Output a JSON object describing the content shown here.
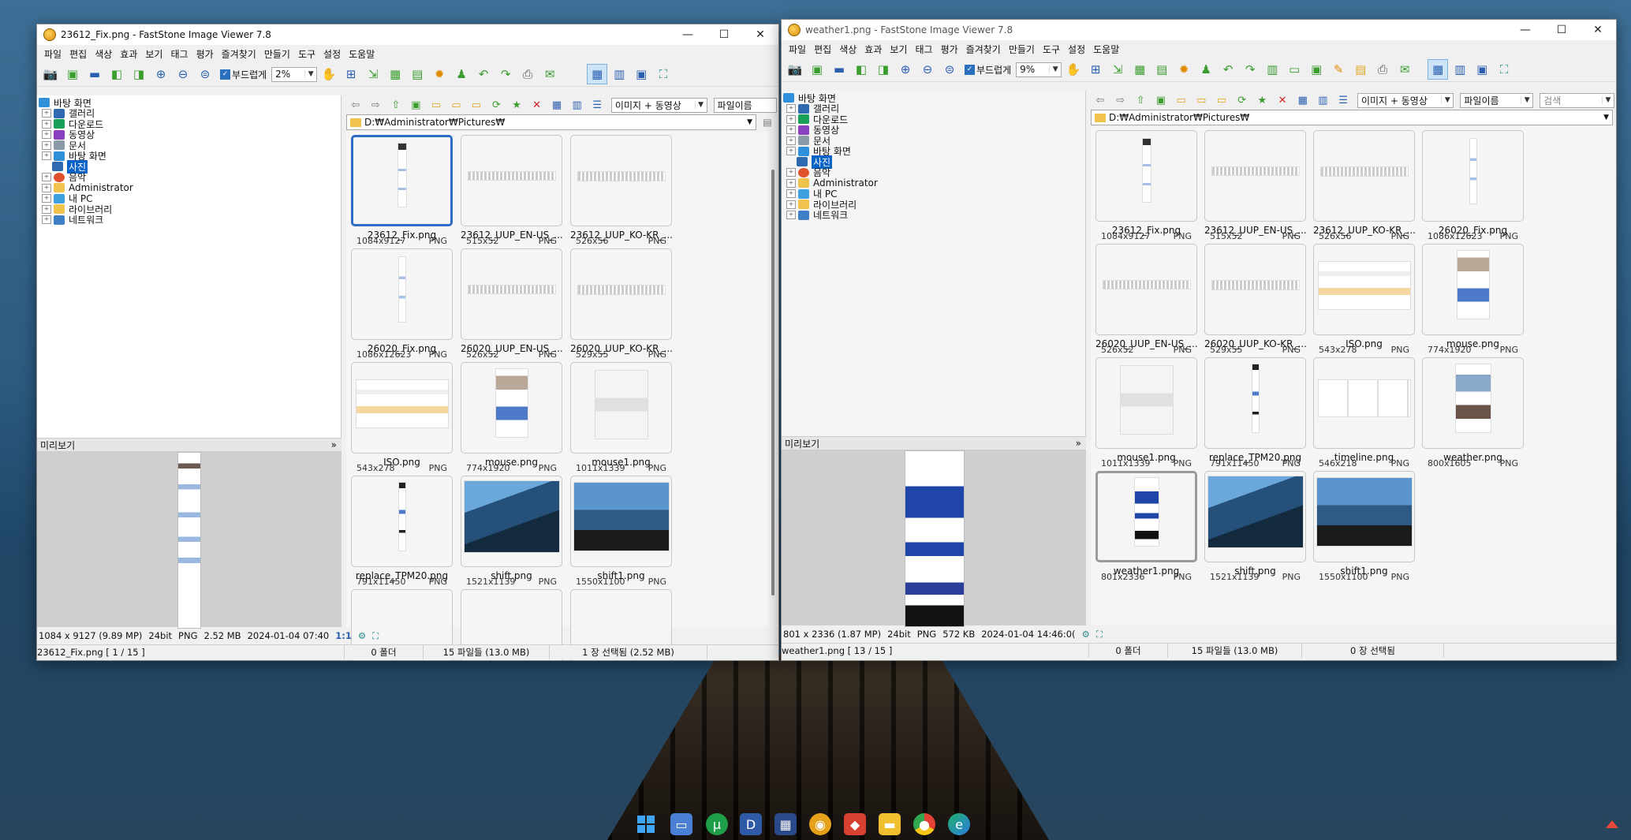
{
  "left_window": {
    "title": "23612_Fix.png  -  FastStone Image Viewer 7.8",
    "menu": [
      "파일",
      "편집",
      "색상",
      "효과",
      "보기",
      "태그",
      "평가",
      "즐겨찾기",
      "만들기",
      "도구",
      "설정",
      "도움말"
    ],
    "smooth_label": "부드럽게",
    "zoom": "2%",
    "filter": "이미지 + 동영상",
    "sort": "파일이름",
    "path": "D:₩Administrator₩Pictures₩",
    "tree": [
      "바탕 화면",
      "갤러리",
      "다운로드",
      "동영상",
      "문서",
      "바탕 화면",
      "사진",
      "음악",
      "Administrator",
      "내 PC",
      "라이브러리",
      "네트워크"
    ],
    "preview_label": "미리보기",
    "thumbs": [
      {
        "dim": "1084x9127",
        "ext": "PNG",
        "name": "23612_Fix.png"
      },
      {
        "dim": "515x52",
        "ext": "PNG",
        "name": "23612_UUP_EN-US_..."
      },
      {
        "dim": "526x56",
        "ext": "PNG",
        "name": "23612_UUP_KO-KR_..."
      },
      {
        "dim": "1086x12623",
        "ext": "PNG",
        "name": "26020_Fix.png"
      },
      {
        "dim": "526x52",
        "ext": "PNG",
        "name": "26020_UUP_EN-US_..."
      },
      {
        "dim": "529x55",
        "ext": "PNG",
        "name": "26020_UUP_KO-KR_..."
      },
      {
        "dim": "543x278",
        "ext": "PNG",
        "name": "ISO.png"
      },
      {
        "dim": "774x1920",
        "ext": "PNG",
        "name": "mouse.png"
      },
      {
        "dim": "1011x1339",
        "ext": "PNG",
        "name": "mouse1.png"
      },
      {
        "dim": "791x11450",
        "ext": "PNG",
        "name": "replace_TPM20.png"
      },
      {
        "dim": "1521x1139",
        "ext": "PNG",
        "name": "shift.png"
      },
      {
        "dim": "1550x1100",
        "ext": "PNG",
        "name": "shift1.png"
      }
    ],
    "info": {
      "dims": "1084 x 9127 (9.89 MP)",
      "depth": "24bit",
      "type": "PNG",
      "size": "2.52 MB",
      "date": "2024-01-04 07:40",
      "ratio": "1:1"
    },
    "status": {
      "file": "23612_Fix.png [ 1 / 15 ]",
      "folders": "0 폴더",
      "files": "15 파일들 (13.0 MB)",
      "selected": "1 장 선택됨 (2.52 MB)"
    }
  },
  "right_window": {
    "title": "weather1.png  -  FastStone Image Viewer 7.8",
    "menu": [
      "파일",
      "편집",
      "색상",
      "효과",
      "보기",
      "태그",
      "평가",
      "즐겨찾기",
      "만들기",
      "도구",
      "설정",
      "도움말"
    ],
    "smooth_label": "부드럽게",
    "zoom": "9%",
    "filter": "이미지 + 동영상",
    "sort": "파일이름",
    "search_placeholder": "검색",
    "path": "D:₩Administrator₩Pictures₩",
    "tree": [
      "바탕 화면",
      "갤러리",
      "다운로드",
      "동영상",
      "문서",
      "바탕 화면",
      "사진",
      "음악",
      "Administrator",
      "내 PC",
      "라이브러리",
      "네트워크"
    ],
    "preview_label": "미리보기",
    "thumbs": [
      {
        "dim": "1084x9127",
        "ext": "PNG",
        "name": "23612_Fix.png"
      },
      {
        "dim": "515x52",
        "ext": "PNG",
        "name": "23612_UUP_EN-US_..."
      },
      {
        "dim": "526x56",
        "ext": "PNG",
        "name": "23612_UUP_KO-KR_..."
      },
      {
        "dim": "1086x12623",
        "ext": "PNG",
        "name": "26020_Fix.png"
      },
      {
        "dim": "526x52",
        "ext": "PNG",
        "name": "26020_UUP_EN-US_..."
      },
      {
        "dim": "529x55",
        "ext": "PNG",
        "name": "26020_UUP_KO-KR_..."
      },
      {
        "dim": "543x278",
        "ext": "PNG",
        "name": "ISO.png"
      },
      {
        "dim": "774x1920",
        "ext": "PNG",
        "name": "mouse.png"
      },
      {
        "dim": "1011x1339",
        "ext": "PNG",
        "name": "mouse1.png"
      },
      {
        "dim": "791x11450",
        "ext": "PNG",
        "name": "replace_TPM20.png"
      },
      {
        "dim": "546x218",
        "ext": "PNG",
        "name": "timeline.png"
      },
      {
        "dim": "800x1605",
        "ext": "PNG",
        "name": "weather.png"
      },
      {
        "dim": "801x2336",
        "ext": "PNG",
        "name": "weather1.png"
      },
      {
        "dim": "1521x1139",
        "ext": "PNG",
        "name": "shift.png"
      },
      {
        "dim": "1550x1100",
        "ext": "PNG",
        "name": "shift1.png"
      }
    ],
    "info": {
      "dims": "801 x 2336 (1.87 MP)",
      "depth": "24bit",
      "type": "PNG",
      "size": "572 KB",
      "date": "2024-01-04 14:46:0(",
      "ratio": "1:1"
    },
    "status": {
      "file": "weather1.png [ 13 / 15 ]",
      "folders": "0 폴더",
      "files": "15 파일들 (13.0 MB)",
      "selected": "0 장 선택됨"
    }
  },
  "taskbar": {
    "icons": [
      "windows-start",
      "chat",
      "utorrent",
      "app-d",
      "calendar",
      "faststone",
      "pdf",
      "file-explorer",
      "chrome",
      "edge-can"
    ]
  },
  "colors": {
    "selection": "#0a64c8",
    "thumb_selected": "#2d6cc4"
  }
}
